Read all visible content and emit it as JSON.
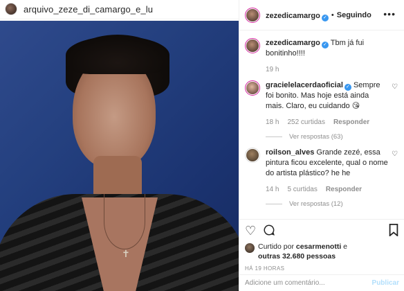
{
  "watermark": {
    "account": "arquivo_zeze_di_camargo_e_lu"
  },
  "header": {
    "username": "zezedicamargo",
    "separator": "•",
    "follow_status": "Seguindo"
  },
  "comments": [
    {
      "username": "zezedicamargo",
      "text": "Tbm já fui bonitinho!!!!",
      "time": "19 h"
    },
    {
      "username": "gracielelacerdaoficial",
      "text": "Sempre foi bonito. Mas hoje está ainda mais. Claro, eu cuidando 😘",
      "time": "18 h",
      "likes": "252 curtidas",
      "reply": "Responder",
      "view_replies": "Ver respostas (63)"
    },
    {
      "username": "roilson_alves",
      "text": "Grande zezé, essa pintura ficou excelente, qual o nome do artista plástico? he he",
      "time": "14 h",
      "likes": "5 curtidas",
      "reply": "Responder",
      "view_replies": "Ver respostas (12)"
    }
  ],
  "liked_by": {
    "prefix": "Curtido por",
    "user": "cesarmenotti",
    "suffix": "e",
    "others": "outras 32.680 pessoas"
  },
  "timestamp": "HÁ 19 HORAS",
  "add_comment": {
    "placeholder": "Adicione um comentário...",
    "publish": "Publicar"
  }
}
